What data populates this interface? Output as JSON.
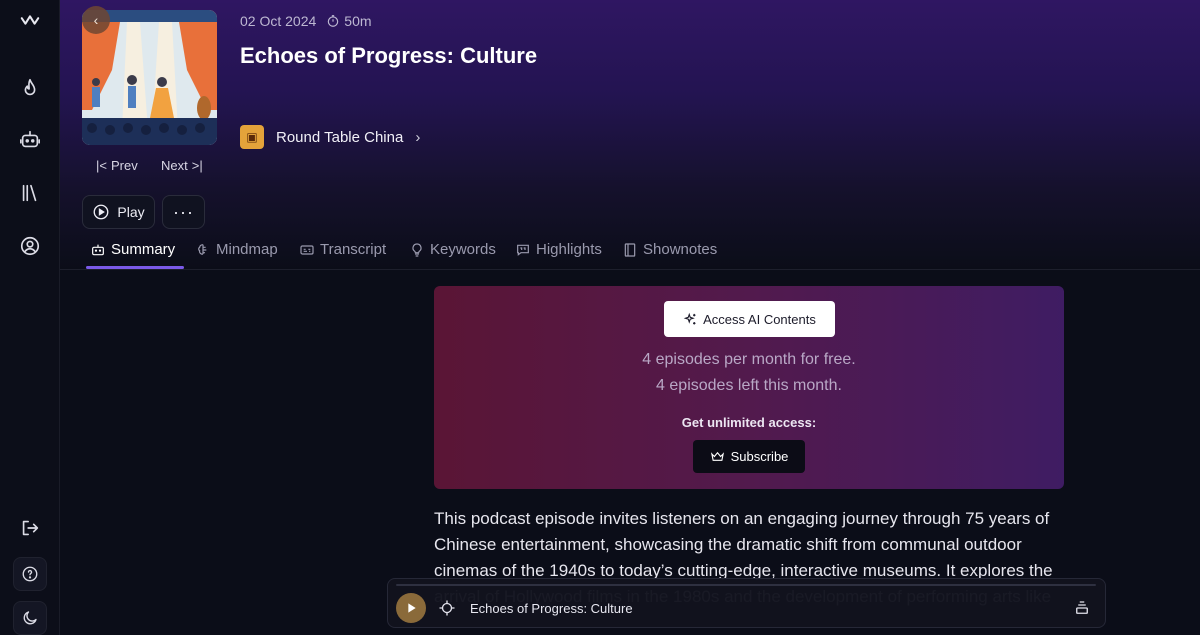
{
  "episode": {
    "date": "02 Oct 2024",
    "duration": "50m",
    "title": "Echoes of Progress: Culture",
    "channel": "Round Table China"
  },
  "nav": {
    "prev_label": "Prev",
    "next_label": "Next",
    "play_label": "Play"
  },
  "tabs": [
    {
      "label": "Summary"
    },
    {
      "label": "Mindmap"
    },
    {
      "label": "Transcript"
    },
    {
      "label": "Keywords"
    },
    {
      "label": "Highlights"
    },
    {
      "label": "Shownotes"
    }
  ],
  "promo": {
    "access_label": "Access AI Contents",
    "line1": "4 episodes per month for free.",
    "line2": "4 episodes left this month.",
    "cta": "Get unlimited access:",
    "subscribe_label": "Subscribe"
  },
  "summary": {
    "text": "This podcast episode invites listeners on an engaging journey through 75 years of Chinese entertainment, showcasing the dramatic shift from communal outdoor cinemas of the 1940s to today’s cutting-edge, interactive museums. It explores the arrival of Hollywood films in the 1980s and the development of performing arts like"
  },
  "player": {
    "title": "Echoes of Progress: Culture"
  },
  "colors": {
    "accent": "#7b5ae8",
    "hero_top": "#2f1662",
    "promo_left": "#5a1535",
    "promo_right": "#3f1c63"
  }
}
